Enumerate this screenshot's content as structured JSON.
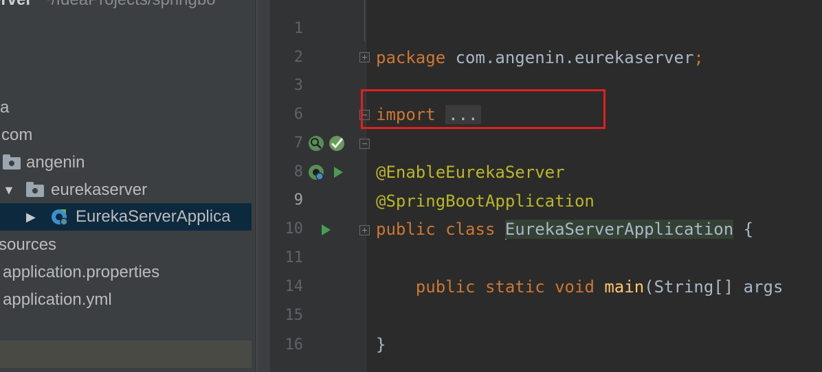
{
  "sidebar": {
    "project_name": "erver",
    "project_path": "~/IdeaProjects/springbo",
    "tree": [
      {
        "label": "a"
      },
      {
        "label": "com"
      },
      {
        "label": "angenin"
      },
      {
        "label": "eurekaserver"
      },
      {
        "label": "EurekaServerApplica"
      },
      {
        "label": "sources"
      },
      {
        "label": "application.properties"
      },
      {
        "label": "application.yml"
      }
    ]
  },
  "editor": {
    "lines": [
      {
        "no": "1",
        "tokens": [
          "package",
          " com.angenin.eurekaserver",
          ";"
        ]
      },
      {
        "no": "2"
      },
      {
        "no": "3",
        "tokens": [
          "import",
          " ",
          "..."
        ]
      },
      {
        "no": "6"
      },
      {
        "no": "7",
        "tokens": [
          "@EnableEurekaServer"
        ]
      },
      {
        "no": "8",
        "tokens": [
          "@SpringBootApplication"
        ]
      },
      {
        "no": "9",
        "tokens": [
          "public",
          " ",
          "class",
          " ",
          "EurekaServerApplication",
          " {"
        ]
      },
      {
        "no": "10"
      },
      {
        "no": "11",
        "tokens": [
          "    ",
          "public",
          " ",
          "static",
          " ",
          "void",
          " ",
          "main",
          "(String[] args"
        ]
      },
      {
        "no": "14"
      },
      {
        "no": "15",
        "tokens": [
          "}"
        ]
      },
      {
        "no": "16"
      }
    ]
  },
  "colors": {
    "keyword": "#cc7832",
    "annotation": "#bbb529",
    "text": "#a9b7c6",
    "method": "#ffc66d",
    "highlight_border": "#e02020",
    "selection": "#0d293e"
  },
  "icons": {
    "run": "run-triangle-icon",
    "spring_bean": "spring-bean-icon",
    "package": "package-folder-icon"
  }
}
